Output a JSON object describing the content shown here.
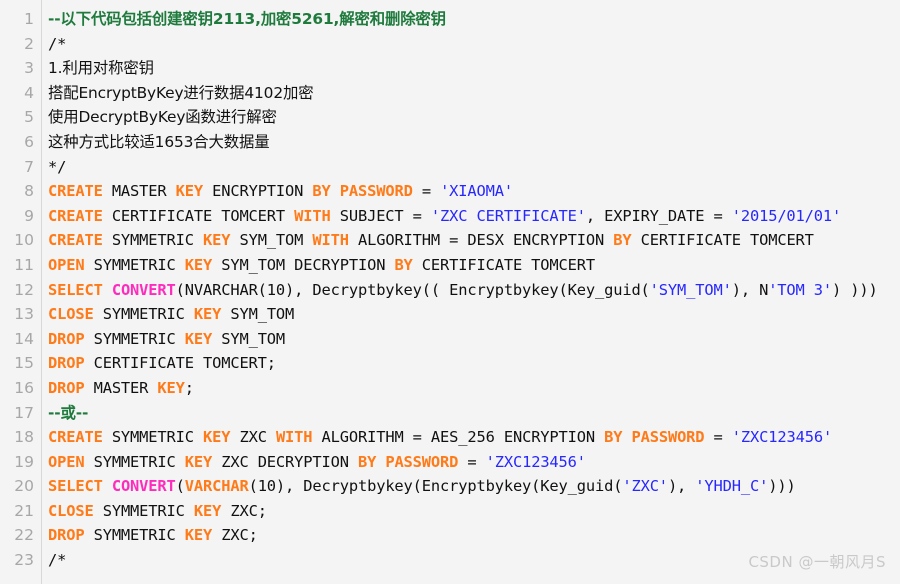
{
  "editor": {
    "background_color": "#f4f4f4",
    "gutter_color": "#a7a7a7",
    "language": "SQL",
    "colors": {
      "keyword": "#ff7a18",
      "function": "#ff2bbd",
      "string": "#2727ff",
      "comment": "#1f7a3d",
      "plain": "#111111"
    }
  },
  "watermark": {
    "text": "CSDN @一朝风月S"
  },
  "lines": [
    {
      "number": "1",
      "tokens": [
        {
          "t": "--以下代码包括创建密钥2113,加密5261,解密和删除密钥",
          "c": "cmt"
        }
      ]
    },
    {
      "number": "2",
      "tokens": [
        {
          "t": "/*",
          "c": "plain"
        }
      ]
    },
    {
      "number": "3",
      "tokens": [
        {
          "t": "1.利用对称密钥",
          "c": "plain"
        }
      ]
    },
    {
      "number": "4",
      "tokens": [
        {
          "t": "搭配EncryptByKey进行数据4102加密",
          "c": "plain"
        }
      ]
    },
    {
      "number": "5",
      "tokens": [
        {
          "t": "使用DecryptByKey函数进行解密",
          "c": "plain"
        }
      ]
    },
    {
      "number": "6",
      "tokens": [
        {
          "t": "这种方式比较适1653合大数据量",
          "c": "plain"
        }
      ]
    },
    {
      "number": "7",
      "tokens": [
        {
          "t": "*/",
          "c": "plain"
        }
      ]
    },
    {
      "number": "8",
      "tokens": [
        {
          "t": "CREATE",
          "c": "kw"
        },
        {
          "t": " MASTER ",
          "c": "plain"
        },
        {
          "t": "KEY",
          "c": "kw"
        },
        {
          "t": " ENCRYPTION ",
          "c": "plain"
        },
        {
          "t": "BY",
          "c": "kw"
        },
        {
          "t": " ",
          "c": "plain"
        },
        {
          "t": "PASSWORD",
          "c": "kw"
        },
        {
          "t": " = ",
          "c": "plain"
        },
        {
          "t": "'XIAOMA'",
          "c": "str"
        }
      ]
    },
    {
      "number": "9",
      "tokens": [
        {
          "t": "CREATE",
          "c": "kw"
        },
        {
          "t": " CERTIFICATE TOMCERT ",
          "c": "plain"
        },
        {
          "t": "WITH",
          "c": "kw"
        },
        {
          "t": " SUBJECT = ",
          "c": "plain"
        },
        {
          "t": "'ZXC CERTIFICATE'",
          "c": "str"
        },
        {
          "t": ", EXPIRY_DATE = ",
          "c": "plain"
        },
        {
          "t": "'2015/01/01'",
          "c": "str"
        }
      ]
    },
    {
      "number": "10",
      "tokens": [
        {
          "t": "CREATE",
          "c": "kw"
        },
        {
          "t": " SYMMETRIC ",
          "c": "plain"
        },
        {
          "t": "KEY",
          "c": "kw"
        },
        {
          "t": " SYM_TOM ",
          "c": "plain"
        },
        {
          "t": "WITH",
          "c": "kw"
        },
        {
          "t": " ALGORITHM = DESX ENCRYPTION ",
          "c": "plain"
        },
        {
          "t": "BY",
          "c": "kw"
        },
        {
          "t": " CERTIFICATE TOMCERT",
          "c": "plain"
        }
      ]
    },
    {
      "number": "11",
      "tokens": [
        {
          "t": "OPEN",
          "c": "kw"
        },
        {
          "t": " SYMMETRIC ",
          "c": "plain"
        },
        {
          "t": "KEY",
          "c": "kw"
        },
        {
          "t": " SYM_TOM DECRYPTION ",
          "c": "plain"
        },
        {
          "t": "BY",
          "c": "kw"
        },
        {
          "t": " CERTIFICATE TOMCERT",
          "c": "plain"
        }
      ]
    },
    {
      "number": "12",
      "tokens": [
        {
          "t": "SELECT",
          "c": "kw"
        },
        {
          "t": " ",
          "c": "plain"
        },
        {
          "t": "CONVERT",
          "c": "fn"
        },
        {
          "t": "(NVARCHAR(10), Decryptbykey(( Encryptbykey(Key_guid(",
          "c": "plain"
        },
        {
          "t": "'SYM_TOM'",
          "c": "str"
        },
        {
          "t": "), N",
          "c": "plain"
        },
        {
          "t": "'TOM 3'",
          "c": "str"
        },
        {
          "t": ") )))",
          "c": "plain"
        }
      ]
    },
    {
      "number": "13",
      "tokens": [
        {
          "t": "CLOSE",
          "c": "kw"
        },
        {
          "t": " SYMMETRIC ",
          "c": "plain"
        },
        {
          "t": "KEY",
          "c": "kw"
        },
        {
          "t": " SYM_TOM",
          "c": "plain"
        }
      ]
    },
    {
      "number": "14",
      "tokens": [
        {
          "t": "DROP",
          "c": "kw"
        },
        {
          "t": " SYMMETRIC ",
          "c": "plain"
        },
        {
          "t": "KEY",
          "c": "kw"
        },
        {
          "t": " SYM_TOM",
          "c": "plain"
        }
      ]
    },
    {
      "number": "15",
      "tokens": [
        {
          "t": "DROP",
          "c": "kw"
        },
        {
          "t": " CERTIFICATE TOMCERT;",
          "c": "plain"
        }
      ]
    },
    {
      "number": "16",
      "tokens": [
        {
          "t": "DROP",
          "c": "kw"
        },
        {
          "t": " MASTER ",
          "c": "plain"
        },
        {
          "t": "KEY",
          "c": "kw"
        },
        {
          "t": ";",
          "c": "plain"
        }
      ]
    },
    {
      "number": "17",
      "tokens": [
        {
          "t": "--或--",
          "c": "cmt"
        }
      ]
    },
    {
      "number": "18",
      "tokens": [
        {
          "t": "CREATE",
          "c": "kw"
        },
        {
          "t": " SYMMETRIC ",
          "c": "plain"
        },
        {
          "t": "KEY",
          "c": "kw"
        },
        {
          "t": " ZXC ",
          "c": "plain"
        },
        {
          "t": "WITH",
          "c": "kw"
        },
        {
          "t": " ALGORITHM = AES_256 ENCRYPTION ",
          "c": "plain"
        },
        {
          "t": "BY",
          "c": "kw"
        },
        {
          "t": " ",
          "c": "plain"
        },
        {
          "t": "PASSWORD",
          "c": "kw"
        },
        {
          "t": " = ",
          "c": "plain"
        },
        {
          "t": "'ZXC123456'",
          "c": "str"
        }
      ]
    },
    {
      "number": "19",
      "tokens": [
        {
          "t": "OPEN",
          "c": "kw"
        },
        {
          "t": " SYMMETRIC ",
          "c": "plain"
        },
        {
          "t": "KEY",
          "c": "kw"
        },
        {
          "t": " ZXC DECRYPTION ",
          "c": "plain"
        },
        {
          "t": "BY",
          "c": "kw"
        },
        {
          "t": " ",
          "c": "plain"
        },
        {
          "t": "PASSWORD",
          "c": "kw"
        },
        {
          "t": " = ",
          "c": "plain"
        },
        {
          "t": "'ZXC123456'",
          "c": "str"
        }
      ]
    },
    {
      "number": "20",
      "tokens": [
        {
          "t": "SELECT",
          "c": "kw"
        },
        {
          "t": " ",
          "c": "plain"
        },
        {
          "t": "CONVERT",
          "c": "fn"
        },
        {
          "t": "(",
          "c": "plain"
        },
        {
          "t": "VARCHAR",
          "c": "kw"
        },
        {
          "t": "(10), Decryptbykey(Encryptbykey(Key_guid(",
          "c": "plain"
        },
        {
          "t": "'ZXC'",
          "c": "str"
        },
        {
          "t": "), ",
          "c": "plain"
        },
        {
          "t": "'YHDH_C'",
          "c": "str"
        },
        {
          "t": ")))",
          "c": "plain"
        }
      ]
    },
    {
      "number": "21",
      "tokens": [
        {
          "t": "CLOSE",
          "c": "kw"
        },
        {
          "t": " SYMMETRIC ",
          "c": "plain"
        },
        {
          "t": "KEY",
          "c": "kw"
        },
        {
          "t": " ZXC;",
          "c": "plain"
        }
      ]
    },
    {
      "number": "22",
      "tokens": [
        {
          "t": "DROP",
          "c": "kw"
        },
        {
          "t": " SYMMETRIC ",
          "c": "plain"
        },
        {
          "t": "KEY",
          "c": "kw"
        },
        {
          "t": " ZXC;",
          "c": "plain"
        }
      ]
    },
    {
      "number": "23",
      "tokens": [
        {
          "t": "/*",
          "c": "plain"
        }
      ]
    }
  ]
}
